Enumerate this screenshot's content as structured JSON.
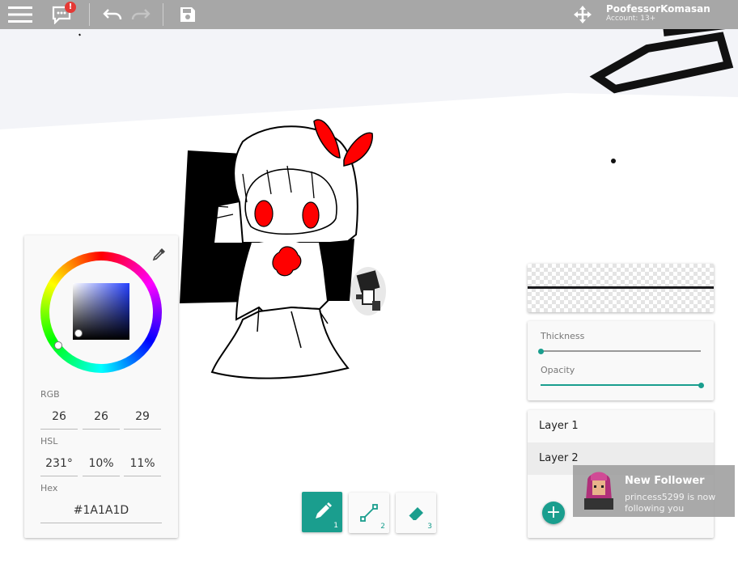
{
  "topbar": {
    "notification_count": "!",
    "account_name": "PoofessorKomasan",
    "account_status": "Account: 13+"
  },
  "color_picker": {
    "rgb_label": "RGB",
    "rgb": [
      "26",
      "26",
      "29"
    ],
    "hsl_label": "HSL",
    "hsl": [
      "231°",
      "10%",
      "11%"
    ],
    "hex_label": "Hex",
    "hex": "#1A1A1D",
    "current_color": "#1A1A1D"
  },
  "brush": {
    "thickness_label": "Thickness",
    "thickness": 0.0,
    "opacity_label": "Opacity",
    "opacity": 1.0
  },
  "layers": {
    "items": [
      {
        "label": "Layer 1"
      },
      {
        "label": "Layer 2"
      }
    ],
    "selected_index": 1,
    "add_label": "+"
  },
  "tools": [
    {
      "name": "pencil",
      "index": "1",
      "active": true
    },
    {
      "name": "line",
      "index": "2",
      "active": false
    },
    {
      "name": "eraser",
      "index": "3",
      "active": false
    }
  ],
  "notification": {
    "title": "New Follower",
    "message": "princess5299 is now following you"
  },
  "colors": {
    "accent": "#1a9e8e",
    "topbar": "#a7a7a7",
    "badge": "#e53935",
    "drawing_red": "#ff0000"
  }
}
